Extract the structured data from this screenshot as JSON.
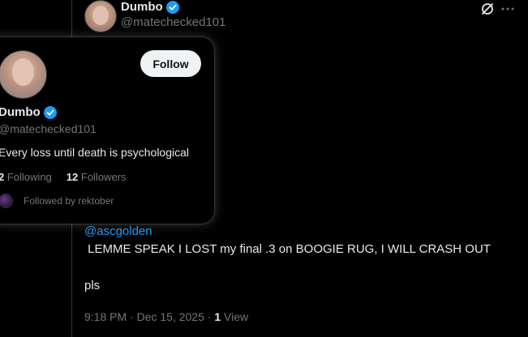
{
  "post": {
    "author_name": "Dumbo",
    "author_handle": "@matechecked101",
    "mention": "@ascgolden",
    "text_line1": " LEMME SPEAK I LOST my final .3 on BOOGIE RUG, I WILL CRASH OUT",
    "text_line2": "pls",
    "timestamp": "9:18 PM · Dec 15, 2025",
    "separator": " · ",
    "views_count": "1",
    "views_label": " View"
  },
  "hovercard": {
    "name": "Dumbo",
    "handle": "@matechecked101",
    "follow_label": "Follow",
    "bio": "Every loss until death is psychological",
    "following_count": "2",
    "following_label": "Following",
    "followers_count": "12",
    "followers_label": "Followers",
    "followed_by": "Followed by rektober"
  },
  "icons": {
    "verified": "verified-badge-icon",
    "grok": "grok-icon",
    "more": "more-horizontal-icon"
  },
  "colors": {
    "background": "#000000",
    "accent": "#1d9bf0",
    "text": "#e7e9ea",
    "muted": "#71767b",
    "follow_button": "#eff3f4"
  }
}
